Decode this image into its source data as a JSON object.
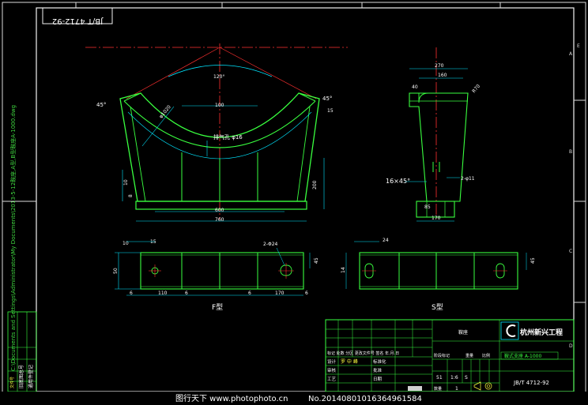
{
  "sheet": {
    "code_box": "JB/T 4712-92",
    "view_f_label": "F型",
    "view_s_label": "S型",
    "left_strip_text": "C:\\Documents and Settings\\Administrator\\My Documents\\2013-5-12鞍座,A型,B型鞍座A-1000.dwg"
  },
  "dims": {
    "angle_120": "120°",
    "r_500": "R500",
    "phi1020": "φ1020",
    "d_100": "100",
    "vent_hole": "排气孔 φ16",
    "angle_45": "45°",
    "d_15": "15",
    "d_10a": "10",
    "d_8a": "8",
    "d_200": "200",
    "d_600": "600",
    "d_760": "760",
    "s_270": "270",
    "s_160": "160",
    "s_40": "40",
    "s_r70": "R70",
    "chamfer": "16×45°",
    "holes_11": "2-φ11",
    "s_85": "85",
    "s_170": "170",
    "p_10": "10",
    "p_15": "15",
    "p_4_24": "2-Φ24",
    "p_50": "50",
    "p_6a": "6",
    "p_110": "110",
    "p_6b": "6",
    "p_6c": "6",
    "p_170": "170",
    "p_6d": "6",
    "p_45": "45",
    "q_24": "24",
    "q_45": "45",
    "q_14": "14"
  },
  "title_block": {
    "part_name": "鞍座",
    "company": "杭州新兴工程",
    "drawing_no": "JB/T 4712-92",
    "spec": "鞍式支座 A-1000",
    "rev_header": "标记 处数 分区 更改文件号 签名 年.月.日",
    "designer_label": "设计",
    "designer_name": "罗 中 峰",
    "review_label": "审核",
    "process_label": "工艺",
    "standard_label": "标准化",
    "approve_label": "批准",
    "date_label": "日期",
    "stage_label": "阶段标记",
    "weight_label": "重量",
    "scale_label": "比例",
    "weight_val": "51",
    "scale_val": "1:6",
    "stage_val": "S",
    "sheets_label": "共 张 第 张",
    "sheet_count": "1",
    "quantity_label": "数量"
  },
  "border": {
    "col_labels": [
      "1",
      "2",
      "3",
      "4",
      "5",
      "6"
    ],
    "row_labels": [
      "A",
      "B",
      "C",
      "D",
      "E"
    ]
  },
  "left_table": {
    "lines": [
      "文件号",
      "更改标记",
      "签名",
      "日期",
      "通用件登记",
      "旧底图总号"
    ]
  },
  "watermark": {
    "site": "图行天下 www.photophoto.cn",
    "id": "No.20140801016364961584"
  },
  "colors": {
    "line": "#39ff3f",
    "dim": "#00e5ff",
    "center": "#ff3030",
    "text": "#ffffff",
    "frame": "#e8e8e8",
    "label_yellow": "#ffff40"
  }
}
